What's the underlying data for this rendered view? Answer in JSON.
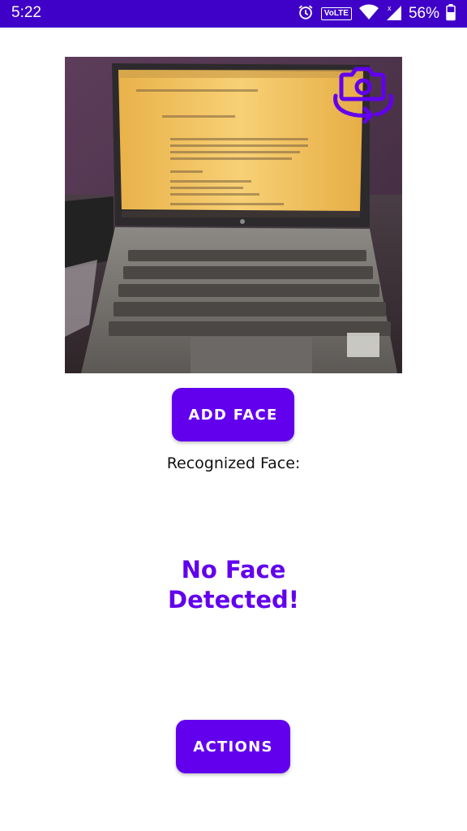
{
  "status_bar": {
    "time": "5:22",
    "volte_label": "VoLTE",
    "battery_percent": "56%"
  },
  "camera": {
    "switch_icon": "switch-camera-icon"
  },
  "buttons": {
    "add_face": "ADD FACE",
    "actions": "ACTIONS"
  },
  "recognized_label": "Recognized Face:",
  "face_result": "No Face Detected!",
  "colors": {
    "status_bar": "#3f00c8",
    "accent": "#6200ee",
    "background": "#ffffff"
  }
}
